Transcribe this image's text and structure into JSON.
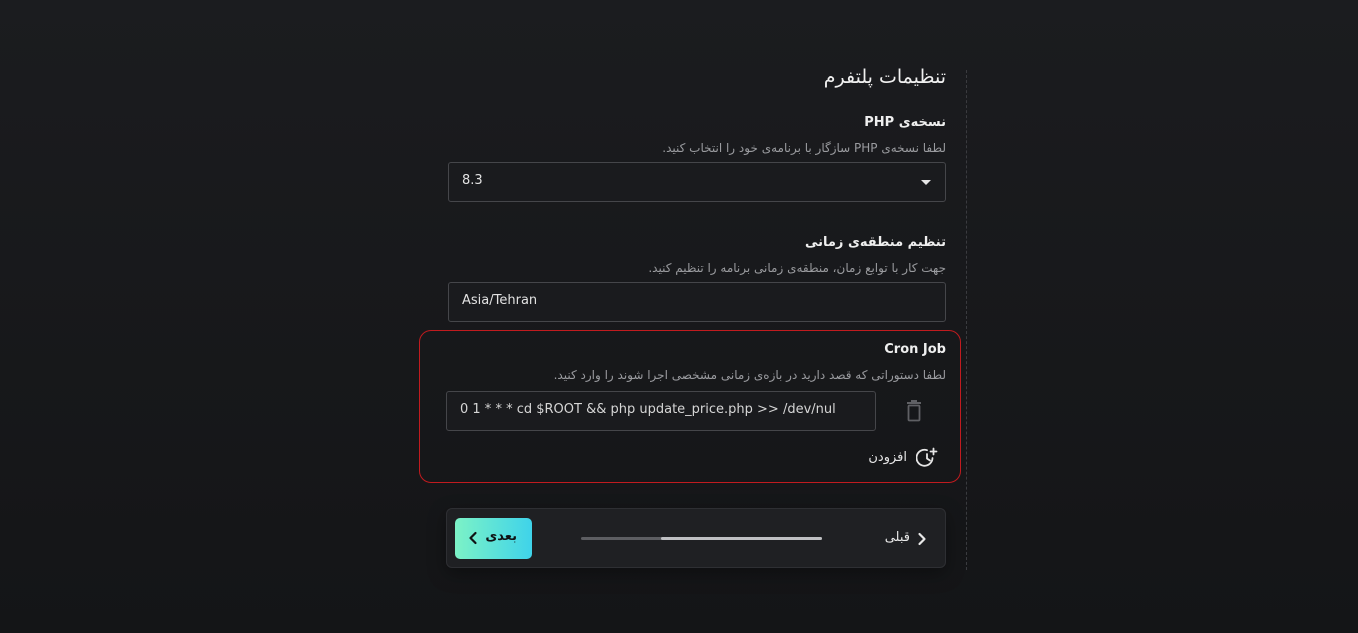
{
  "form": {
    "title": "تنظیمات پلتفرم",
    "php": {
      "label": "نسخه‌ی PHP",
      "hint": "لطفا نسخه‌ی PHP سازگار با برنامه‌ی خود را انتخاب کنید.",
      "selected": "8.3"
    },
    "timezone": {
      "label": "تنظیم منطقه‌ی زمانی",
      "hint": "جهت کار با توابع زمان، منطقه‌ی زمانی برنامه را تنظیم کنید.",
      "value": "Asia/Tehran"
    },
    "cron": {
      "label": "Cron Job",
      "hint": "لطفا دستوراتی که قصد دارید در بازه‌ی زمانی مشخصی اجرا شوند را وارد کنید.",
      "entries": [
        {
          "command": "0 1 * * * cd $ROOT && php update_price.php >> /dev/nul"
        }
      ],
      "add_label": "افزودن",
      "highlight_color": "#c11b1f"
    }
  },
  "footer": {
    "next_label": "بعدی",
    "prev_label": "قبلی",
    "progress_fraction": 0.67
  },
  "icons": {
    "select_caret": "chevron-down-icon",
    "delete": "trash-icon",
    "add": "clock-plus-icon",
    "next": "chevron-left-icon",
    "prev": "chevron-right-icon"
  },
  "colors": {
    "accent_gradient_start": "#7cf2c6",
    "accent_gradient_end": "#3fd3ea",
    "background": "#18191c"
  }
}
